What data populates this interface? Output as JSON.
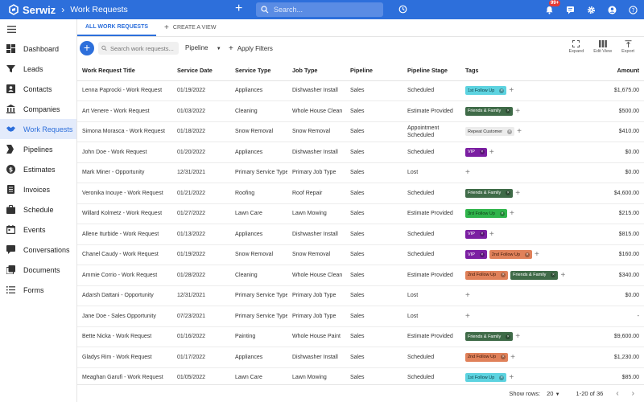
{
  "app": {
    "name": "Serwiz",
    "page": "Work Requests"
  },
  "topbar": {
    "search_placeholder": "Search...",
    "notif_badge": "99+"
  },
  "sidebar": {
    "items": [
      {
        "label": "Dashboard",
        "icon": "dashboard-icon"
      },
      {
        "label": "Leads",
        "icon": "filter-icon"
      },
      {
        "label": "Contacts",
        "icon": "contacts-icon"
      },
      {
        "label": "Companies",
        "icon": "companies-icon"
      },
      {
        "label": "Work Requests",
        "icon": "handshake-icon"
      },
      {
        "label": "Pipelines",
        "icon": "pipelines-icon"
      },
      {
        "label": "Estimates",
        "icon": "estimates-icon"
      },
      {
        "label": "Invoices",
        "icon": "invoices-icon"
      },
      {
        "label": "Schedule",
        "icon": "briefcase-icon"
      },
      {
        "label": "Events",
        "icon": "calendar-icon"
      },
      {
        "label": "Conversations",
        "icon": "chat-icon"
      },
      {
        "label": "Documents",
        "icon": "documents-icon"
      },
      {
        "label": "Forms",
        "icon": "list-icon"
      }
    ],
    "active_index": 4
  },
  "tabs": {
    "all": "ALL WORK REQUESTS",
    "create": "CREATE A VIEW"
  },
  "toolbar": {
    "search_placeholder": "Search work requests...",
    "pipeline_label": "Pipeline",
    "apply_filters": "Apply Filters",
    "expand": "Expand",
    "edit_view": "Edit View",
    "export": "Export"
  },
  "table": {
    "headers": [
      "Work Request Title",
      "Service Date",
      "Service Type",
      "Job Type",
      "Pipeline",
      "Pipeline Stage",
      "Tags",
      "Amount"
    ],
    "rows": [
      {
        "title": "Lenna Paprocki - Work Request",
        "date": "01/19/2022",
        "service": "Appliances",
        "job": "Dishwasher Install",
        "pipeline": "Sales",
        "stage": "Scheduled",
        "tags": [
          {
            "t": "1st Follow Up",
            "bg": "#5dd3e0",
            "fg": "#0b3c44"
          }
        ],
        "amount": "$1,675.00"
      },
      {
        "title": "Art Venere - Work Request",
        "date": "01/03/2022",
        "service": "Cleaning",
        "job": "Whole House Clean",
        "pipeline": "Sales",
        "stage": "Estimate Provided",
        "tags": [
          {
            "t": "Friends & Family",
            "bg": "#3f6b48",
            "fg": "#ffffff"
          }
        ],
        "amount": "$500.00"
      },
      {
        "title": "Simona Morasca - Work Request",
        "date": "01/18/2022",
        "service": "Snow Removal",
        "job": "Snow Removal",
        "pipeline": "Sales",
        "stage": "Appointment Scheduled",
        "tags": [
          {
            "t": "Repeat Customer",
            "bg": "#ececec",
            "fg": "#333333"
          }
        ],
        "amount": "$410.00"
      },
      {
        "title": "John Doe - Work Request",
        "date": "01/20/2022",
        "service": "Appliances",
        "job": "Dishwasher Install",
        "pipeline": "Sales",
        "stage": "Scheduled",
        "tags": [
          {
            "t": "VIP",
            "bg": "#7b1fa2",
            "fg": "#ffffff"
          }
        ],
        "amount": "$0.00"
      },
      {
        "title": "Mark Miner - Opportunity",
        "date": "12/31/2021",
        "service": "Primary Service Type",
        "job": "Primary Job Type",
        "pipeline": "Sales",
        "stage": "Lost",
        "tags": [],
        "amount": "$0.00"
      },
      {
        "title": "Veronika Inouye - Work Request",
        "date": "01/21/2022",
        "service": "Roofing",
        "job": "Roof Repair",
        "pipeline": "Sales",
        "stage": "Scheduled",
        "tags": [
          {
            "t": "Friends & Family",
            "bg": "#3f6b48",
            "fg": "#ffffff"
          }
        ],
        "amount": "$4,600.00"
      },
      {
        "title": "Willard Kolmetz - Work Request",
        "date": "01/27/2022",
        "service": "Lawn Care",
        "job": "Lawn Mowing",
        "pipeline": "Sales",
        "stage": "Estimate Provided",
        "tags": [
          {
            "t": "3rd Follow Up",
            "bg": "#2fb44b",
            "fg": "#0f3a18"
          }
        ],
        "amount": "$215.00"
      },
      {
        "title": "Allene Iturbide - Work Request",
        "date": "01/13/2022",
        "service": "Appliances",
        "job": "Dishwasher Install",
        "pipeline": "Sales",
        "stage": "Scheduled",
        "tags": [
          {
            "t": "VIP",
            "bg": "#7b1fa2",
            "fg": "#ffffff"
          }
        ],
        "amount": "$815.00"
      },
      {
        "title": "Chanel Caudy - Work Request",
        "date": "01/19/2022",
        "service": "Snow Removal",
        "job": "Snow Removal",
        "pipeline": "Sales",
        "stage": "Scheduled",
        "tags": [
          {
            "t": "VIP",
            "bg": "#7b1fa2",
            "fg": "#ffffff"
          },
          {
            "t": "2nd Follow Up",
            "bg": "#e0815a",
            "fg": "#3d1a0c"
          }
        ],
        "amount": "$160.00"
      },
      {
        "title": "Ammie Corrio - Work Request",
        "date": "01/28/2022",
        "service": "Cleaning",
        "job": "Whole House Clean",
        "pipeline": "Sales",
        "stage": "Estimate Provided",
        "tags": [
          {
            "t": "2nd Follow Up",
            "bg": "#e0815a",
            "fg": "#3d1a0c"
          },
          {
            "t": "Friends & Family",
            "bg": "#3f6b48",
            "fg": "#ffffff"
          }
        ],
        "amount": "$340.00"
      },
      {
        "title": "Adarsh Dattani - Opportunity",
        "date": "12/31/2021",
        "service": "Primary Service Type",
        "job": "Primary Job Type",
        "pipeline": "Sales",
        "stage": "Lost",
        "tags": [],
        "amount": "$0.00"
      },
      {
        "title": "Jane Doe - Sales Opportunity",
        "date": "07/23/2021",
        "service": "Primary Service Type",
        "job": "Primary Job Type",
        "pipeline": "Sales",
        "stage": "Lost",
        "tags": [],
        "amount": "-"
      },
      {
        "title": "Bette Nicka - Work Request",
        "date": "01/16/2022",
        "service": "Painting",
        "job": "Whole House Paint",
        "pipeline": "Sales",
        "stage": "Estimate Provided",
        "tags": [
          {
            "t": "Friends & Family",
            "bg": "#3f6b48",
            "fg": "#ffffff"
          }
        ],
        "amount": "$9,600.00"
      },
      {
        "title": "Gladys Rim - Work Request",
        "date": "01/17/2022",
        "service": "Appliances",
        "job": "Dishwasher Install",
        "pipeline": "Sales",
        "stage": "Scheduled",
        "tags": [
          {
            "t": "2nd Follow Up",
            "bg": "#e0815a",
            "fg": "#3d1a0c"
          }
        ],
        "amount": "$1,230.00"
      },
      {
        "title": "Meaghan Garufi - Work Request",
        "date": "01/05/2022",
        "service": "Lawn Care",
        "job": "Lawn Mowing",
        "pipeline": "Sales",
        "stage": "Scheduled",
        "tags": [
          {
            "t": "1st Follow Up",
            "bg": "#5dd3e0",
            "fg": "#0b3c44"
          }
        ],
        "amount": "$85.00"
      }
    ]
  },
  "footer": {
    "show_rows_label": "Show rows:",
    "rows_value": "20",
    "range": "1-20 of 36"
  },
  "colors": {
    "brand": "#2d6fdb",
    "active_bg": "#e3ebfb"
  }
}
